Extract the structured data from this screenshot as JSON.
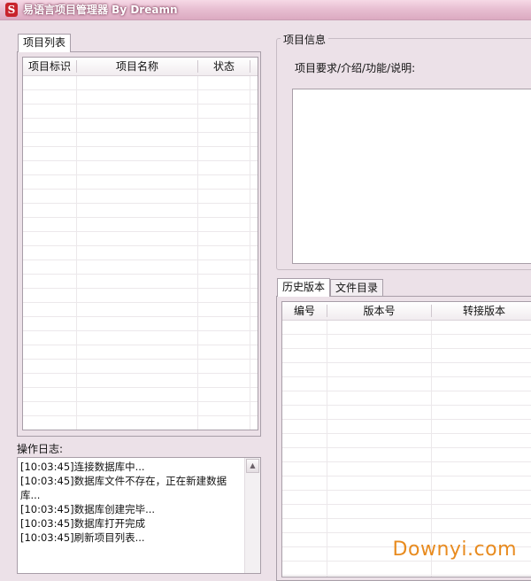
{
  "window": {
    "title": "易语言项目管理器 By Dreamn",
    "icon": "app-logo-icon"
  },
  "project_list": {
    "tab_label": "项目列表",
    "columns": [
      "项目标识",
      "项目名称",
      "状态"
    ]
  },
  "project_info": {
    "legend": "项目信息",
    "description_label": "项目要求/介绍/功能/说明:"
  },
  "bottom_tabs": {
    "history_label": "历史版本",
    "files_label": "文件目录",
    "columns": [
      "编号",
      "版本号",
      "转接版本"
    ]
  },
  "log": {
    "label": "操作日志:",
    "lines": [
      "[10:03:45]连接数据库中...",
      "[10:03:45]数据库文件不存在，正在新建数据库...",
      "[10:03:45]数据库创建完毕...",
      "[10:03:45]数据库打开完成",
      "[10:03:45]刷新项目列表..."
    ]
  },
  "watermark": "Downyi.com",
  "colors": {
    "background": "#ece1e8",
    "titlebar": "#dcaac1",
    "watermark": "#e88b1f"
  }
}
